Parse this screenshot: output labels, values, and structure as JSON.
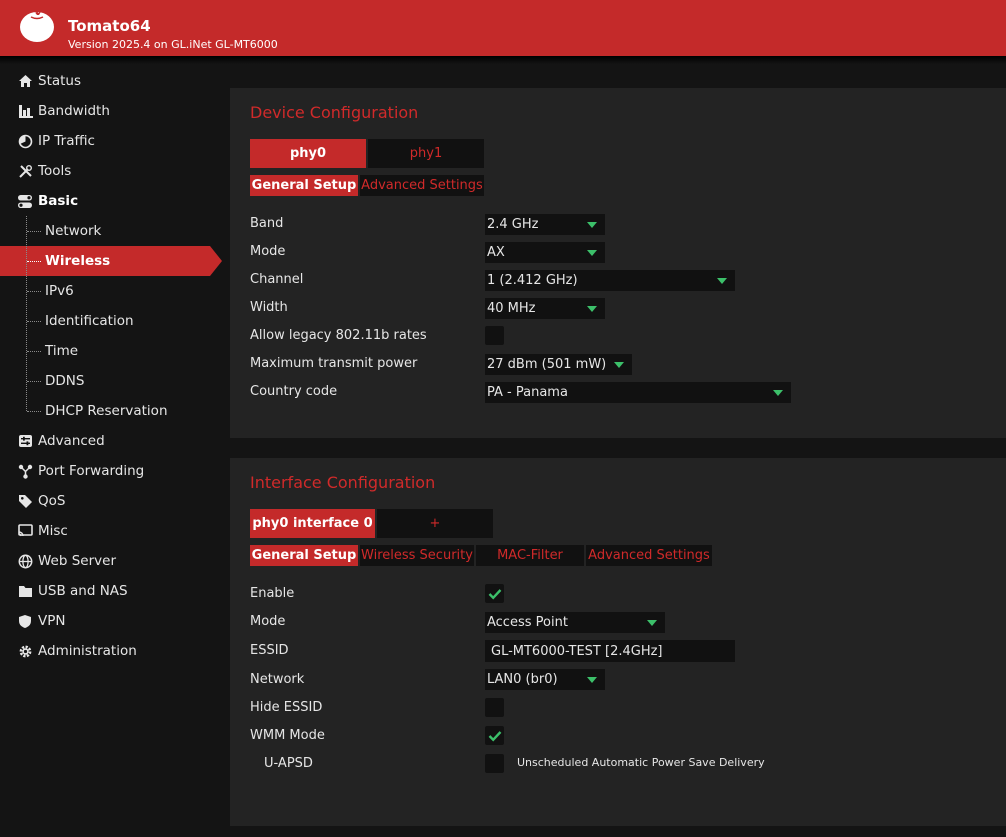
{
  "header": {
    "title": "Tomato64",
    "subtitle": "Version 2025.4 on GL.iNet GL-MT6000",
    "logo_icon": "tomato-logo"
  },
  "sidebar": {
    "items": [
      {
        "label": "Status",
        "icon": "home-icon"
      },
      {
        "label": "Bandwidth",
        "icon": "bar-chart-icon"
      },
      {
        "label": "IP Traffic",
        "icon": "pie-icon"
      },
      {
        "label": "Tools",
        "icon": "tools-icon"
      },
      {
        "label": "Basic",
        "icon": "toggle-icon"
      },
      {
        "label": "Advanced",
        "icon": "sliders-icon"
      },
      {
        "label": "Port Forwarding",
        "icon": "share-icon"
      },
      {
        "label": "QoS",
        "icon": "tag-icon"
      },
      {
        "label": "Misc",
        "icon": "cast-icon"
      },
      {
        "label": "Web Server",
        "icon": "globe-icon"
      },
      {
        "label": "USB and NAS",
        "icon": "folder-icon"
      },
      {
        "label": "VPN",
        "icon": "shield-icon"
      },
      {
        "label": "Administration",
        "icon": "gear-icon"
      }
    ],
    "basic_sub": [
      "Network",
      "Wireless",
      "IPv6",
      "Identification",
      "Time",
      "DDNS",
      "DHCP Reservation"
    ],
    "active": "Wireless"
  },
  "device": {
    "title": "Device Configuration",
    "tabs": [
      "phy0",
      "phy1"
    ],
    "subtabs": [
      "General Setup",
      "Advanced Settings"
    ],
    "band_label": "Band",
    "band_value": "2.4 GHz",
    "mode_label": "Mode",
    "mode_value": "AX",
    "channel_label": "Channel",
    "channel_value": "1 (2.412 GHz)",
    "width_label": "Width",
    "width_value": "40 MHz",
    "legacy_label": "Allow legacy 802.11b rates",
    "legacy_checked": false,
    "power_label": "Maximum transmit power",
    "power_value": "27 dBm (501 mW)",
    "country_label": "Country code",
    "country_value": "PA - Panama"
  },
  "iface": {
    "title": "Interface Configuration",
    "tabs": [
      "phy0 interface 0",
      "+"
    ],
    "subtabs": [
      "General Setup",
      "Wireless Security",
      "MAC-Filter",
      "Advanced Settings"
    ],
    "enable_label": "Enable",
    "enable_checked": true,
    "mode_label": "Mode",
    "mode_value": "Access Point",
    "essid_label": "ESSID",
    "essid_value": "GL-MT6000-TEST [2.4GHz]",
    "network_label": "Network",
    "network_value": "LAN0 (br0)",
    "hide_label": "Hide ESSID",
    "hide_checked": false,
    "wmm_label": "WMM Mode",
    "wmm_checked": true,
    "uapsd_label": "U-APSD",
    "uapsd_checked": false,
    "uapsd_note": "Unscheduled Automatic Power Save Delivery"
  },
  "colors": {
    "accent": "#c42a2a",
    "check": "#3cc06a",
    "panel": "#232323",
    "background": "#141414"
  }
}
